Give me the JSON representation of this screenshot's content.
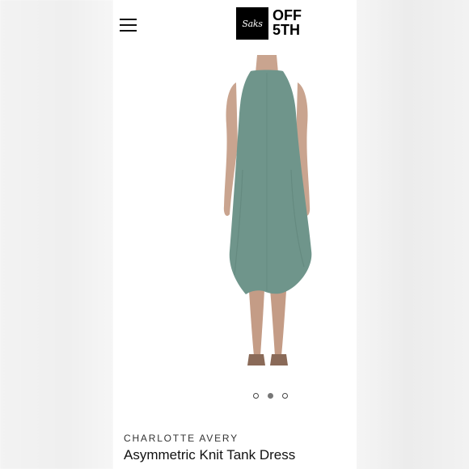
{
  "header": {
    "menu_icon": "hamburger-menu-icon",
    "logo": {
      "box_text": "Saks",
      "line1": "OFF",
      "line2": "5TH"
    }
  },
  "product": {
    "image": "product-photo-dress-back-view",
    "dress_color": "#6f958b",
    "carousel": {
      "total": 3,
      "active_index": 1
    },
    "brand": "CHARLOTTE AVERY",
    "title": "Asymmetric Knit Tank Dress"
  }
}
